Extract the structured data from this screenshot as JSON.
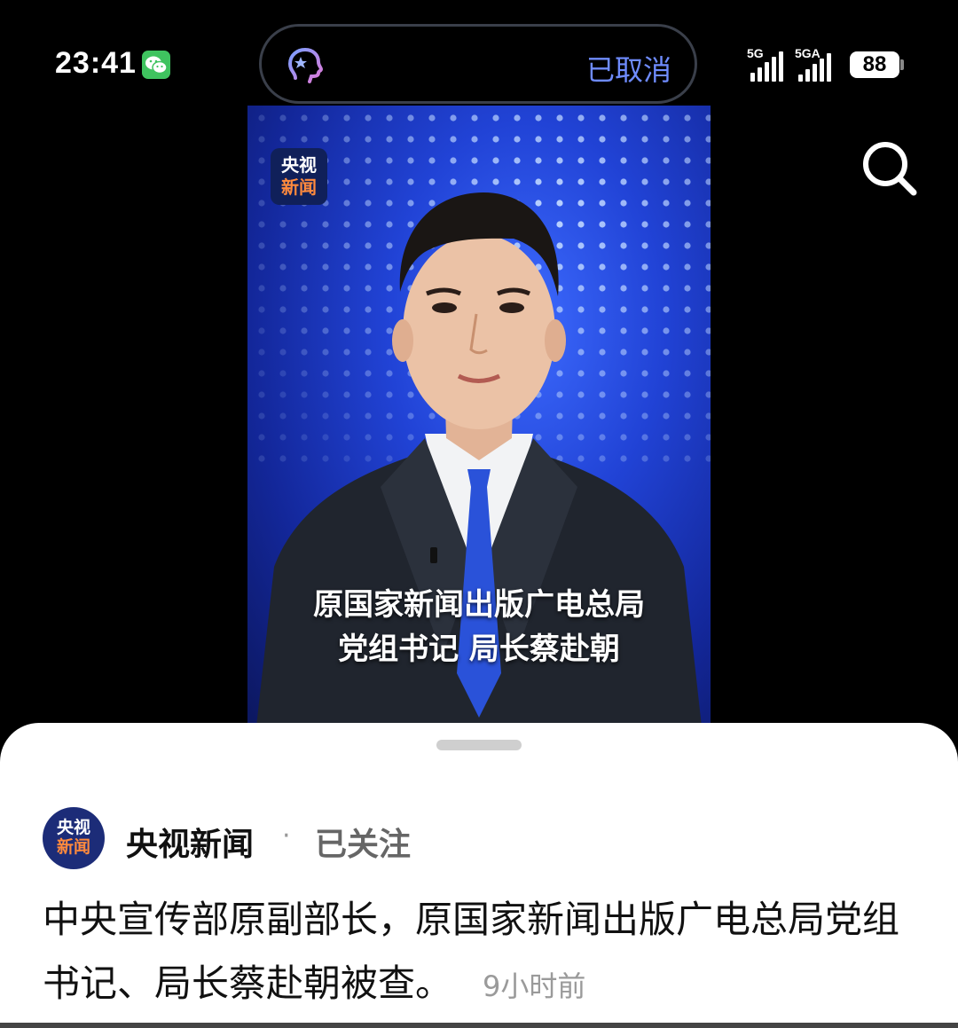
{
  "status_bar": {
    "time": "23:41",
    "island_text": "已取消",
    "signal1_label": "5G",
    "signal2_label": "5GA",
    "battery": "88"
  },
  "video": {
    "logo_line1": "央视",
    "logo_line2": "新闻",
    "subtitle_line1": "原国家新闻出版广电总局",
    "subtitle_line2": "党组书记 局长蔡赴朝"
  },
  "post": {
    "avatar_line1": "央视",
    "avatar_line2": "新闻",
    "account_name": "央视新闻",
    "separator": "·",
    "follow_status": "已关注",
    "text": "中央宣传部原副部长，原国家新闻出版广电总局党组书记、局长蔡赴朝被查。",
    "time": "9小时前"
  },
  "icons": {
    "wechat": "wechat-icon",
    "assistant": "ai-assistant-icon",
    "search": "search-icon"
  },
  "colors": {
    "island_text": "#6f8cff",
    "wechat_green": "#3fc35f",
    "video_blue": "#2143d6"
  }
}
